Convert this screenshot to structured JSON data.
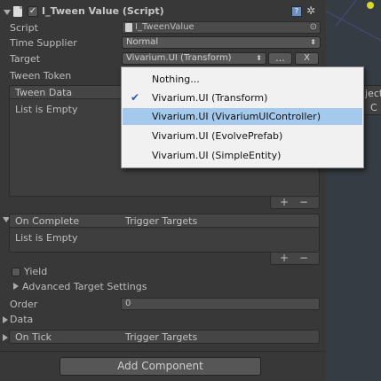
{
  "component": {
    "title": "I_Tween Value (Script)",
    "enabled_mark": "✓"
  },
  "fields": {
    "script_label": "Script",
    "script_value": "I_TweenValue",
    "time_supplier_label": "Time Supplier",
    "time_supplier_value": "Normal",
    "target_label": "Target",
    "target_value": "Vivarium.UI (Transform)",
    "target_more": "...",
    "target_clear": "X",
    "tween_token_label": "Tween Token"
  },
  "tween_data": {
    "header": "Tween Data",
    "empty": "List is Empty",
    "add": "+",
    "remove": "−"
  },
  "on_complete": {
    "header": "On Complete",
    "column": "Trigger Targets",
    "empty": "List is Empty",
    "add": "+",
    "remove": "−"
  },
  "options": {
    "yield_label": "Yield",
    "advanced_label": "Advanced Target Settings",
    "order_label": "Order",
    "order_value": "0",
    "data_label": "Data"
  },
  "on_tick": {
    "header": "On Tick",
    "column": "Trigger Targets"
  },
  "add_component_label": "Add Component",
  "scene_snippets": {
    "top": "ject",
    "bottom": "C"
  },
  "dropdown": {
    "items": [
      {
        "label": "Nothing...",
        "checked": false,
        "hover": false
      },
      {
        "label": "Vivarium.UI (Transform)",
        "checked": true,
        "hover": false
      },
      {
        "label": "Vivarium.UI (VivariumUIController)",
        "checked": false,
        "hover": true
      },
      {
        "label": "Vivarium.UI (EvolvePrefab)",
        "checked": false,
        "hover": false
      },
      {
        "label": "Vivarium.UI (SimpleEntity)",
        "checked": false,
        "hover": false
      }
    ],
    "check_glyph": "✔"
  },
  "colors": {
    "background": "#383838",
    "menu_background": "#f1f1f1",
    "menu_hover": "#a4c9ec"
  }
}
